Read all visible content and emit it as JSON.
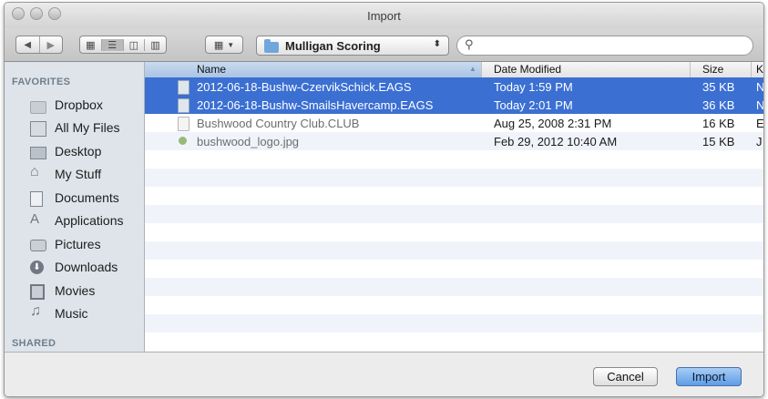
{
  "window": {
    "title": "Import"
  },
  "toolbar": {
    "location": "Mulligan Scoring",
    "location_arrows": "⌃⌄",
    "search_placeholder": ""
  },
  "sidebar": {
    "favorites_header": "FAVORITES",
    "shared_header": "SHARED",
    "items": [
      {
        "label": "Dropbox",
        "icon": "folder-icon"
      },
      {
        "label": "All My Files",
        "icon": "all-files-icon"
      },
      {
        "label": "Desktop",
        "icon": "desktop-icon"
      },
      {
        "label": "My Stuff",
        "icon": "home-icon"
      },
      {
        "label": "Documents",
        "icon": "documents-icon"
      },
      {
        "label": "Applications",
        "icon": "applications-icon"
      },
      {
        "label": "Pictures",
        "icon": "camera-icon"
      },
      {
        "label": "Downloads",
        "icon": "download-icon"
      },
      {
        "label": "Movies",
        "icon": "film-icon"
      },
      {
        "label": "Music",
        "icon": "music-icon"
      }
    ]
  },
  "columns": {
    "name": "Name",
    "date": "Date Modified",
    "size": "Size",
    "kind": "K"
  },
  "files": [
    {
      "name": "2012-06-18-Bushw-CzervikSchick.EAGS",
      "date": "Today 1:59 PM",
      "size": "35 KB",
      "kind": "N",
      "selected": true
    },
    {
      "name": "2012-06-18-Bushw-SmailsHavercamp.EAGS",
      "date": "Today 2:01 PM",
      "size": "36 KB",
      "kind": "N",
      "selected": true
    },
    {
      "name": "Bushwood Country Club.CLUB",
      "date": "Aug 25, 2008 2:31 PM",
      "size": "16 KB",
      "kind": "E",
      "selected": false
    },
    {
      "name": "bushwood_logo.jpg",
      "date": "Feb 29, 2012 10:40 AM",
      "size": "15 KB",
      "kind": "J",
      "selected": false
    }
  ],
  "buttons": {
    "cancel": "Cancel",
    "import": "Import"
  },
  "colors": {
    "selection": "#3b6fd2",
    "sidebar_bg": "#dee4ea",
    "default_button": "#5d9de6"
  }
}
